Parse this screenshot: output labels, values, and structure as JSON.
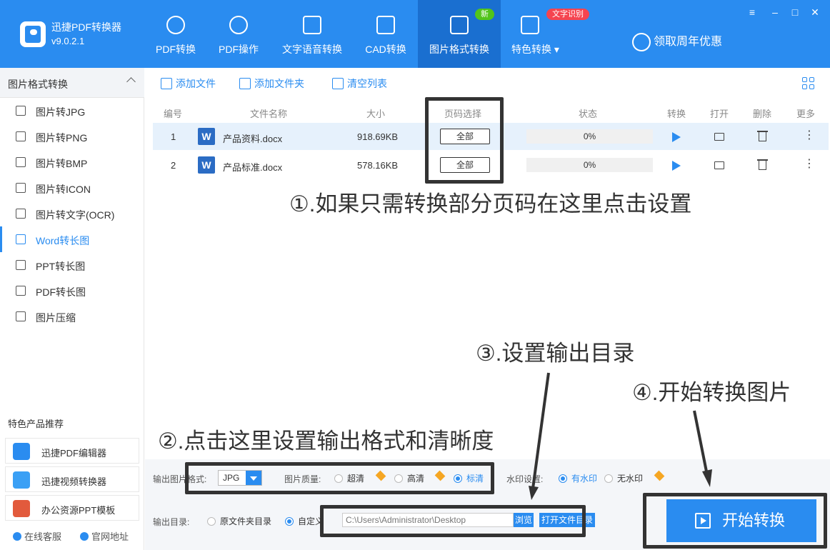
{
  "app": {
    "title": "迅捷PDF转换器",
    "version": "v9.0.2.1"
  },
  "nav": {
    "tabs": [
      {
        "label": "PDF转换",
        "icon": "pdf-convert-icon"
      },
      {
        "label": "PDF操作",
        "icon": "pdf-operation-icon"
      },
      {
        "label": "文字语音转换",
        "icon": "audio-wave-icon"
      },
      {
        "label": "CAD转换",
        "icon": "cad-icon"
      },
      {
        "label": "图片格式转换",
        "icon": "image-icon"
      },
      {
        "label": "特色转换",
        "icon": "star-icon"
      }
    ],
    "badge_new": "新",
    "badge_ocr": "文字识别",
    "promo": "领取周年优惠",
    "colors": {
      "primary": "#2a8cf0",
      "active_tab": "#1a6fd0",
      "badge_new": "#52c41a",
      "badge_ocr": "#f5444f"
    }
  },
  "sidebar": {
    "header": "图片格式转换",
    "items": [
      {
        "label": "图片转JPG"
      },
      {
        "label": "图片转PNG"
      },
      {
        "label": "图片转BMP"
      },
      {
        "label": "图片转ICON"
      },
      {
        "label": "图片转文字(OCR)"
      },
      {
        "label": "Word转长图"
      },
      {
        "label": "PPT转长图"
      },
      {
        "label": "PDF转长图"
      },
      {
        "label": "图片压缩"
      }
    ],
    "featured_title": "特色产品推荐",
    "featured": [
      {
        "label": "迅捷PDF编辑器"
      },
      {
        "label": "迅捷视频转换器"
      },
      {
        "label": "办公资源PPT模板"
      }
    ],
    "footer": {
      "service": "在线客服",
      "website": "官网地址"
    }
  },
  "toolbar": {
    "add_file": "添加文件",
    "add_folder": "添加文件夹",
    "clear_list": "清空列表"
  },
  "table": {
    "headers": {
      "no": "编号",
      "name": "文件名称",
      "size": "大小",
      "pages": "页码选择",
      "status": "状态",
      "convert": "转换",
      "open": "打开",
      "delete": "删除",
      "more": "更多"
    },
    "rows": [
      {
        "no": "1",
        "name": "产品资料.docx",
        "size": "918.69KB",
        "pages": "全部",
        "progress": "0%"
      },
      {
        "no": "2",
        "name": "产品标准.docx",
        "size": "578.16KB",
        "pages": "全部",
        "progress": "0%"
      }
    ]
  },
  "settings": {
    "format_label": "输出图片格式:",
    "format_value": "JPG",
    "quality_label": "图片质量:",
    "quality_options": [
      "超清",
      "高清",
      "标清"
    ],
    "watermark_label": "水印设置:",
    "watermark_options": [
      "有水印",
      "无水印"
    ],
    "output_label": "输出目录:",
    "output_options": [
      "原文件夹目录",
      "自定义"
    ],
    "path": "C:\\Users\\Administrator\\Desktop",
    "browse": "浏览",
    "open_folder": "打开文件目录",
    "start": "开始转换"
  },
  "annotations": {
    "a1": "①.如果只需转换部分页码在这里点击设置",
    "a2": "②.点击这里设置输出格式和清晰度",
    "a3": "③.设置输出目录",
    "a4": "④.开始转换图片"
  }
}
